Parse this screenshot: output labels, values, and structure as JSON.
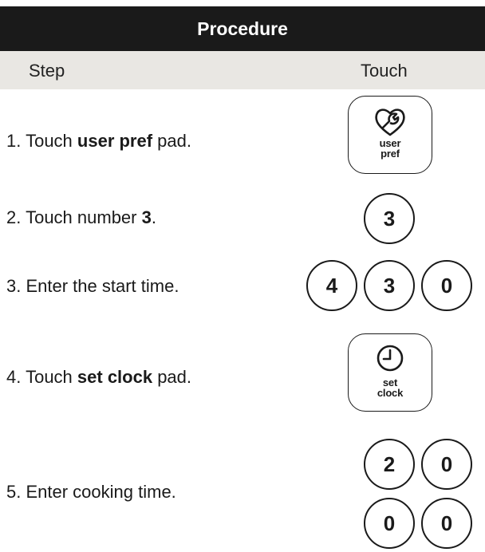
{
  "title": "Procedure",
  "columns": {
    "step": "Step",
    "touch": "Touch"
  },
  "steps": [
    {
      "num": "1.",
      "pre": "Touch ",
      "bold": "user pref",
      "post": " pad."
    },
    {
      "num": "2.",
      "pre": "Touch number ",
      "bold": "3",
      "post": "."
    },
    {
      "num": "3.",
      "pre": "Enter the start time.",
      "bold": "",
      "post": ""
    },
    {
      "num": "4.",
      "pre": "Touch ",
      "bold": "set clock",
      "post": " pad."
    },
    {
      "num": "5.",
      "pre": "Enter cooking time.",
      "bold": "",
      "post": ""
    }
  ],
  "pads": {
    "user_pref": {
      "icon": "wrench-heart-icon",
      "line1": "user",
      "line2": "pref"
    },
    "set_clock": {
      "icon": "clock-icon",
      "line1": "set",
      "line2": "clock"
    }
  },
  "keys": {
    "step2": [
      "3"
    ],
    "step3": [
      "4",
      "3",
      "0"
    ],
    "step5_row1": [
      "2",
      "0"
    ],
    "step5_row2": [
      "0",
      "0"
    ]
  }
}
